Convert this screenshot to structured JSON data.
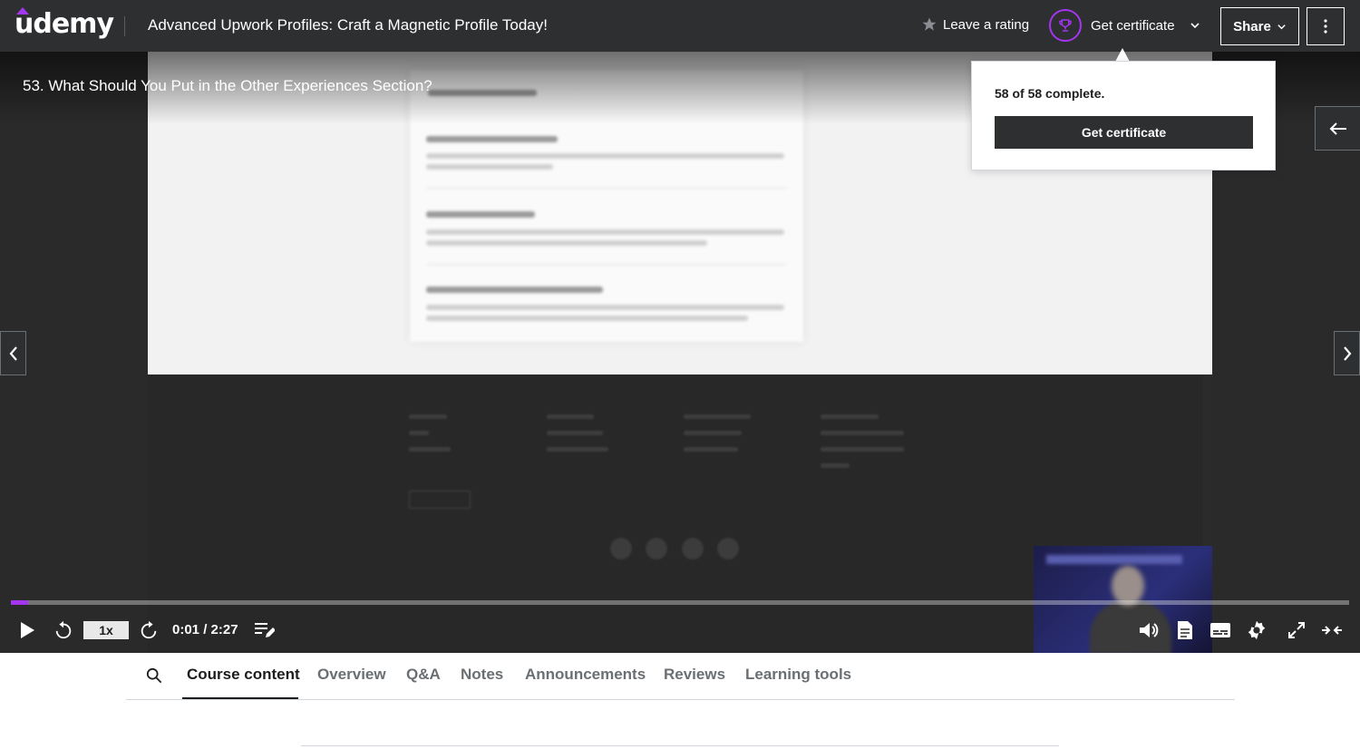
{
  "header": {
    "logo_text": "udemy",
    "course_title": "Advanced Upwork Profiles: Craft a Magnetic Profile Today!",
    "leave_rating_label": "Leave a rating",
    "get_certificate_label": "Get certificate",
    "share_label": "Share"
  },
  "player": {
    "lecture_title": "53. What Should You Put in the Other Experiences Section?",
    "speed": "1x",
    "time": "0:01 / 2:27",
    "progress_fraction": 0.013,
    "accent_color": "#a435f0"
  },
  "certificate_popover": {
    "progress_text": "58 of 58 complete.",
    "button_label": "Get certificate"
  },
  "tabs": [
    {
      "label": "Course content",
      "active": true
    },
    {
      "label": "Overview",
      "active": false
    },
    {
      "label": "Q&A",
      "active": false
    },
    {
      "label": "Notes",
      "active": false
    },
    {
      "label": "Announcements",
      "active": false
    },
    {
      "label": "Reviews",
      "active": false
    },
    {
      "label": "Learning tools",
      "active": false
    }
  ],
  "icons": [
    "star-icon",
    "trophy-icon",
    "chevron-down-icon",
    "more-vertical-icon",
    "arrow-left-icon",
    "chevron-left-icon",
    "chevron-right-icon",
    "play-icon",
    "rewind-icon",
    "forward-icon",
    "playlist-edit-icon",
    "volume-icon",
    "transcript-icon",
    "captions-icon",
    "settings-icon",
    "fullscreen-icon",
    "collapse-icon",
    "search-icon"
  ]
}
